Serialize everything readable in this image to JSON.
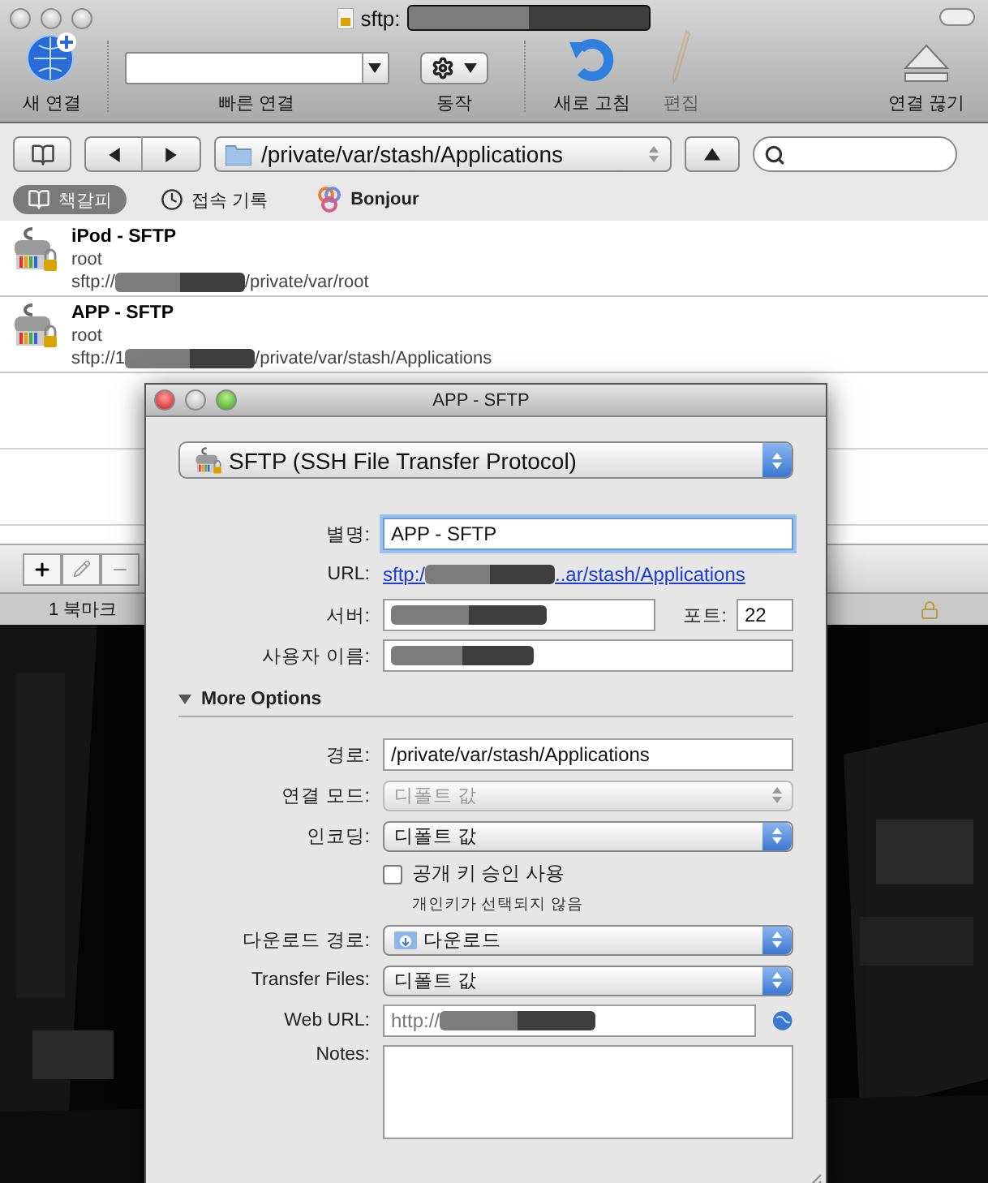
{
  "window": {
    "title": "sftp:"
  },
  "toolbar": [
    {
      "kind": "new",
      "label": "새 연결",
      "disabled": false
    },
    {
      "kind": "quick",
      "label": "빠른 연결",
      "disabled": false
    },
    {
      "kind": "action",
      "label": "동작",
      "disabled": false
    },
    {
      "kind": "refresh",
      "label": "새로 고침",
      "disabled": false
    },
    {
      "kind": "edit",
      "label": "편집",
      "disabled": true
    },
    {
      "kind": "disconnect",
      "label": "연결 끊기",
      "disabled": false
    }
  ],
  "path_bar": {
    "path": "/private/var/stash/Applications"
  },
  "source_tabs": [
    {
      "kind": "bookmarks",
      "label": "책갈피",
      "selected": true
    },
    {
      "kind": "history",
      "label": "접속 기록",
      "selected": false
    },
    {
      "kind": "bonjour",
      "label": "Bonjour",
      "selected": false
    }
  ],
  "bookmarks": [
    {
      "name": "iPod - SFTP",
      "user": "root",
      "url_start": "sftp://",
      "url_end": "/private/var/root"
    },
    {
      "name": "APP - SFTP",
      "user": "root",
      "url_start": "sftp://1",
      "url_end": "/private/var/stash/Applications"
    }
  ],
  "status_bar": {
    "count": "1 북마크"
  },
  "dialog": {
    "title": "APP - SFTP",
    "protocol": "SFTP (SSH File Transfer Protocol)",
    "fields": [
      {
        "kind": "text",
        "label": "별명:",
        "value": "APP - SFTP",
        "focused": true
      },
      {
        "kind": "link",
        "label": "URL:",
        "start": "sftp:/",
        "end": "..ar/stash/Applications"
      },
      {
        "kind": "server",
        "label": "서버:",
        "port_label": "포트:",
        "port": "22"
      },
      {
        "kind": "redacted",
        "label": "사용자 이름:"
      },
      {
        "kind": "disclosure",
        "label": "More Options",
        "expanded": true
      },
      {
        "kind": "text",
        "label": "경로:",
        "value": "/private/var/stash/Applications",
        "focused": false
      },
      {
        "kind": "select",
        "label": "연결 모드:",
        "value": "디폴트 값",
        "disabled": true
      },
      {
        "kind": "select",
        "label": "인코딩:",
        "value": "디폴트 값",
        "disabled": false
      },
      {
        "kind": "checkbox",
        "label": "공개 키 승인 사용",
        "checked": false,
        "note": "개인키가 선택되지 않음"
      },
      {
        "kind": "folder",
        "label": "다운로드 경로:",
        "value": "다운로드"
      },
      {
        "kind": "select",
        "label": "Transfer Files:",
        "value": "디폴트 값",
        "disabled": false
      },
      {
        "kind": "weburl",
        "label": "Web URL:",
        "placeholder": "http://"
      },
      {
        "kind": "notes",
        "label": "Notes:"
      }
    ]
  }
}
